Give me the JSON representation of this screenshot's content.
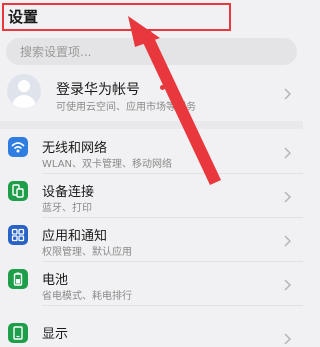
{
  "header": {
    "title": "设置"
  },
  "search": {
    "placeholder": "搜索设置项..."
  },
  "account": {
    "title": "登录华为帐号",
    "subtitle": "可使用云空间、应用市场等服务"
  },
  "items": [
    {
      "title": "无线和网络",
      "subtitle": "WLAN、双卡管理、移动网络",
      "icon": "wifi-icon",
      "color": "#2f7de1"
    },
    {
      "title": "设备连接",
      "subtitle": "蓝牙、打印",
      "icon": "device-connect-icon",
      "color": "#1f9e4a"
    },
    {
      "title": "应用和通知",
      "subtitle": "权限管理、默认应用",
      "icon": "apps-icon",
      "color": "#2a63c7"
    },
    {
      "title": "电池",
      "subtitle": "省电模式、耗电排行",
      "icon": "battery-icon",
      "color": "#1f9e4a"
    },
    {
      "title": "显示",
      "subtitle": "",
      "icon": "display-icon",
      "color": "#1f9e4a"
    }
  ],
  "colors": {
    "highlight": "#e8383d",
    "arrow": "#e8383d"
  }
}
